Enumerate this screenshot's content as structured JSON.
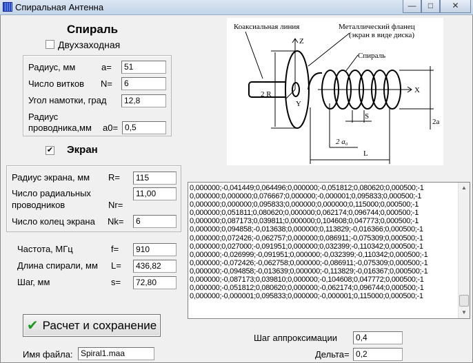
{
  "window": {
    "title": "Спиральная Антенна",
    "minimize": "—",
    "maximize": "□",
    "close": "✕"
  },
  "spiral": {
    "heading": "Спираль",
    "two_start_label": "Двухзаходная",
    "two_start_checked": false,
    "radius_label": "Радиус, мм",
    "radius_sym": "a=",
    "radius_value": "51",
    "turns_label": "Число витков",
    "turns_sym": "N=",
    "turns_value": "6",
    "angle_label": "Угол намотки, град",
    "angle_value": "12,8",
    "wire_label1": "Радиус",
    "wire_label2": "проводника,мм",
    "wire_sym": "a0=",
    "wire_value": "0,5"
  },
  "screen": {
    "heading": "Экран",
    "checked": true,
    "check_glyph": "✔",
    "radius_label": "Радиус экрана, мм",
    "radius_sym": "R=",
    "radius_value": "115",
    "radial_label1": "Число радиальных",
    "radial_label2": "проводников",
    "radial_sym": "Nr=",
    "radial_value": "11,00",
    "rings_label": "Число колец экрана",
    "rings_sym": "Nk=",
    "rings_value": "6"
  },
  "params": {
    "freq_label": "Частота, МГц",
    "freq_sym": "f=",
    "freq_value": "910",
    "length_label": "Длина спирали, мм",
    "length_sym": "L=",
    "length_value": "436,82",
    "step_label": "Шаг, мм",
    "step_sym": "s=",
    "step_value": "72,80"
  },
  "calc_button": {
    "label": "Расчет и сохранение",
    "icon": "checkmark-icon",
    "icon_glyph": "✔"
  },
  "file": {
    "label": "Имя файла:",
    "value": "Spiral1.maa"
  },
  "approx": {
    "step_label": "Шаг аппроксимации",
    "step_value": "0,4",
    "delta_label": "Дельта=",
    "delta_value": "0,2"
  },
  "diagram": {
    "coax": "Коаксиальная линия",
    "flange1": "Металлический фланец",
    "flange2": "(экран в виде диска)",
    "spiral": "Спираль",
    "z": "Z",
    "x": "X",
    "y": "Y",
    "r2": "2 R",
    "a2": "2a",
    "s": "S",
    "a0": "2 a₀",
    "L": "L"
  },
  "output_lines": [
    "0,000000;-0,041449;0,064496;0,000000;-0,051812;0,080620;0,000500;-1",
    "0,000000;0,000000;0,076667;0,000000;-0,000001;0,095833;0,000500;-1",
    "0,000000;0,000000;0,095833;0,000000;0,000000;0,115000;0,000500;-1",
    "0,000000;0,051811;0,080620;0,000000;0,062174;0,096744;0,000500;-1",
    "0,000000;0,087173;0,039811;0,000000;0,104608;0,047773;0,000500;-1",
    "0,000000;0,094858;-0,013638;0,000000;0,113829;-0,016366;0,000500;-1",
    "0,000000;0,072426;-0,062757;0,000000;0,086911;-0,075309;0,000500;-1",
    "0,000000;0,027000;-0,091951;0,000000;0,032399;-0,110342;0,000500;-1",
    "0,000000;-0,026999;-0,091951;0,000000;-0,032399;-0,110342;0,000500;-1",
    "0,000000;-0,072426;-0,062758;0,000000;-0,086911;-0,075309;0,000500;-1",
    "0,000000;-0,094858;-0,013639;0,000000;-0,113829;-0,016367;0,000500;-1",
    "0,000000;-0,087173;0,039810;0,000000;-0,104608;0,047772;0,000500;-1",
    "0,000000;-0,051812;0,080620;0,000000;-0,062174;0,096744;0,000500;-1",
    "0,000000;-0,000001;0,095833;0,000000;-0,000001;0,115000;0,000500;-1"
  ]
}
